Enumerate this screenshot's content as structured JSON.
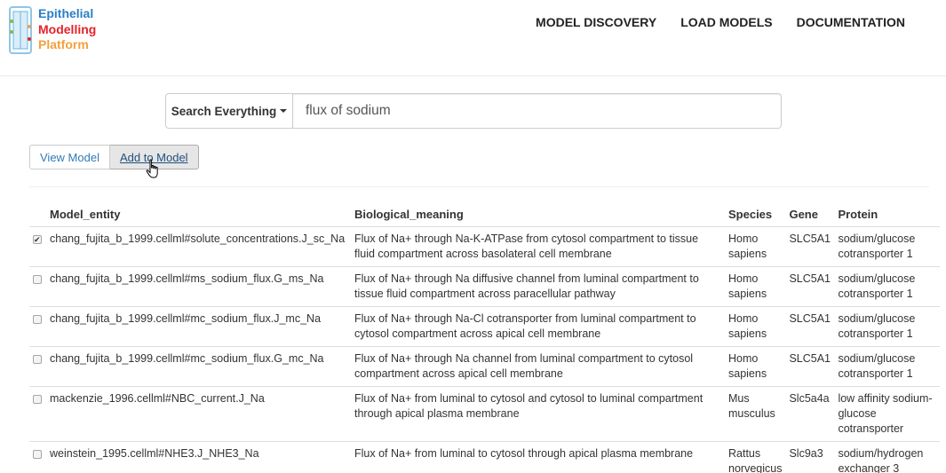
{
  "header": {
    "logo_line1": "Epithelial",
    "logo_line2": "Modelling",
    "logo_line3": "Platform",
    "nav": [
      "MODEL DISCOVERY",
      "LOAD MODELS",
      "DOCUMENTATION"
    ]
  },
  "search": {
    "dropdown_label": "Search Everything",
    "query": "flux of sodium"
  },
  "actions": {
    "view_model_label": "View Model",
    "add_to_model_label": "Add to Model"
  },
  "table": {
    "headers": [
      "Model_entity",
      "Biological_meaning",
      "Species",
      "Gene",
      "Protein"
    ],
    "rows": [
      {
        "checked": true,
        "model_entity": "chang_fujita_b_1999.cellml#solute_concentrations.J_sc_Na",
        "biological_meaning": "Flux of Na+ through Na-K-ATPase from cytosol compartment to tissue fluid compartment across basolateral cell membrane",
        "species": "Homo sapiens",
        "gene": "SLC5A1",
        "protein": "sodium/glucose cotransporter 1"
      },
      {
        "checked": false,
        "model_entity": "chang_fujita_b_1999.cellml#ms_sodium_flux.G_ms_Na",
        "biological_meaning": "Flux of Na+ through Na diffusive channel from luminal compartment to tissue fluid compartment across paracellular pathway",
        "species": "Homo sapiens",
        "gene": "SLC5A1",
        "protein": "sodium/glucose cotransporter 1"
      },
      {
        "checked": false,
        "model_entity": "chang_fujita_b_1999.cellml#mc_sodium_flux.J_mc_Na",
        "biological_meaning": "Flux of Na+ through Na-Cl cotransporter from luminal compartment to cytosol compartment across apical cell membrane",
        "species": "Homo sapiens",
        "gene": "SLC5A1",
        "protein": "sodium/glucose cotransporter 1"
      },
      {
        "checked": false,
        "model_entity": "chang_fujita_b_1999.cellml#mc_sodium_flux.G_mc_Na",
        "biological_meaning": "Flux of Na+ through Na channel from luminal compartment to cytosol compartment across apical cell membrane",
        "species": "Homo sapiens",
        "gene": "SLC5A1",
        "protein": "sodium/glucose cotransporter 1"
      },
      {
        "checked": false,
        "model_entity": "mackenzie_1996.cellml#NBC_current.J_Na",
        "biological_meaning": "Flux of Na+ from luminal to cytosol and cytosol to luminal compartment through apical plasma membrane",
        "species": "Mus musculus",
        "gene": "Slc5a4a",
        "protein": "low affinity sodium-glucose cotransporter"
      },
      {
        "checked": false,
        "model_entity": "weinstein_1995.cellml#NHE3.J_NHE3_Na",
        "biological_meaning": "Flux of Na+ from luminal to cytosol through apical plasma membrane",
        "species": "Rattus norvegicus",
        "gene": "Slc9a3",
        "protein": "sodium/hydrogen exchanger 3"
      }
    ]
  }
}
